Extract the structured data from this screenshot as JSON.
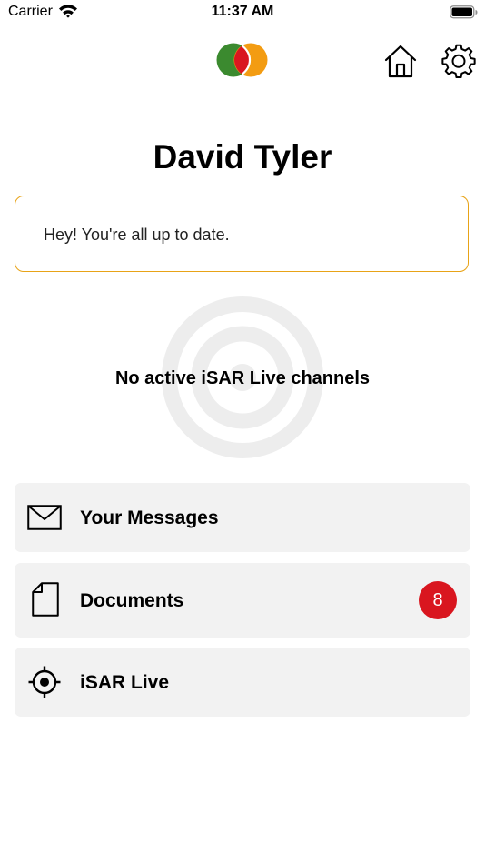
{
  "status_bar": {
    "carrier": "Carrier",
    "time": "11:37 AM",
    "icons": [
      "wifi-icon",
      "battery-icon"
    ]
  },
  "header": {
    "logo_icon": "app-logo-icon",
    "logo_colors": [
      "#3b8a2f",
      "#d9161f",
      "#f39c12"
    ],
    "home_icon": "home-icon",
    "settings_icon": "gear-icon"
  },
  "profile": {
    "name": "David Tyler"
  },
  "notice": {
    "text": "Hey! You're all up to date.",
    "border_color": "#e8a317"
  },
  "live_status": {
    "text": "No active iSAR Live channels",
    "background_icon": "target-icon"
  },
  "menu": {
    "items": [
      {
        "label": "Your Messages",
        "icon": "envelope-icon"
      },
      {
        "label": "Documents",
        "icon": "document-icon",
        "badge": "8",
        "badge_color": "#d9161f"
      },
      {
        "label": "iSAR Live",
        "icon": "crosshair-icon"
      }
    ]
  }
}
